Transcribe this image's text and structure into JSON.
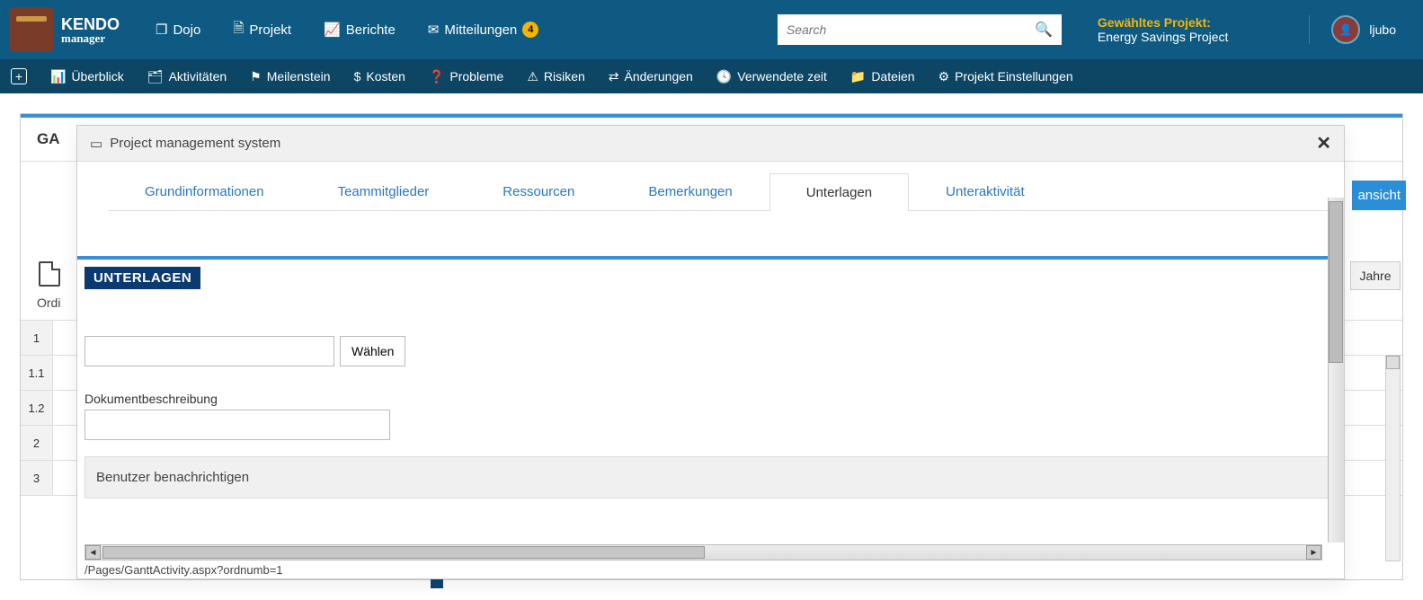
{
  "header": {
    "logo": {
      "line1": "KENDO",
      "line2": "manager"
    },
    "nav": [
      {
        "label": "Dojo"
      },
      {
        "label": "Projekt"
      },
      {
        "label": "Berichte"
      },
      {
        "label": "Mitteilungen",
        "badge": "4"
      }
    ],
    "search_placeholder": "Search",
    "project": {
      "label": "Gewähltes Projekt:",
      "name": "Energy Savings Project"
    },
    "user": "ljubo"
  },
  "subnav": [
    "Überblick",
    "Aktivitäten",
    "Meilenstein",
    "Kosten",
    "Probleme",
    "Risiken",
    "Änderungen",
    "Verwendete zeit",
    "Dateien",
    "Projekt Einstellungen"
  ],
  "page": {
    "title_partial": "GA",
    "right_button_partial": "ansicht",
    "year_label": "Jahre",
    "table_header": "Ordi",
    "rows": [
      "1",
      "1.1",
      "1.2",
      "2",
      "3"
    ]
  },
  "dialog": {
    "title": "Project management system",
    "tabs": [
      "Grundinformationen",
      "Teammitglieder",
      "Ressourcen",
      "Bemerkungen",
      "Unterlagen",
      "Unteraktivität"
    ],
    "active_tab_index": 4,
    "section": "UNTERLAGEN",
    "choose_button": "Wählen",
    "desc_label": "Dokumentbeschreibung",
    "notify_label": "Benutzer benachrichtigen",
    "bottom_path": "/Pages/GanttActivity.aspx?ordnumb=1"
  }
}
